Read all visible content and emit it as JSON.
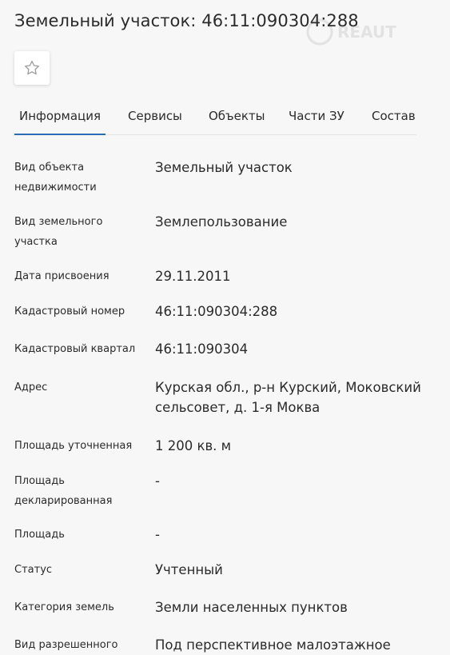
{
  "header": {
    "title": "Земельный участок: 46:11:090304:288",
    "watermark_text": "REAUT"
  },
  "favorite": {
    "icon": "star-outline-icon"
  },
  "tabs": [
    {
      "label": "Информация",
      "active": true
    },
    {
      "label": "Сервисы",
      "active": false
    },
    {
      "label": "Объекты",
      "active": false
    },
    {
      "label": "Части ЗУ",
      "active": false
    },
    {
      "label": "Состав",
      "active": false
    }
  ],
  "details": [
    {
      "label": "Вид объекта недвижимости",
      "value": "Земельный участок"
    },
    {
      "label": "Вид земельного участка",
      "value": "Землепользование"
    },
    {
      "label": "Дата присвоения",
      "value": "29.11.2011"
    },
    {
      "label": "Кадастровый номер",
      "value": "46:11:090304:288"
    },
    {
      "label": "Кадастровый квартал",
      "value": "46:11:090304"
    },
    {
      "label": "Адрес",
      "value": "Курская обл., р-н Курский, Моковский сельсовет, д. 1-я Моква"
    },
    {
      "label": "Площадь уточненная",
      "value": "1 200 кв. м"
    },
    {
      "label": "Площадь декларированная",
      "value": "-"
    },
    {
      "label": "Площадь",
      "value": "-"
    },
    {
      "label": "Статус",
      "value": "Учтенный"
    },
    {
      "label": "Категория земель",
      "value": "Земли населенных пунктов"
    },
    {
      "label": "Вид разрешенного",
      "value": "Под перспективное малоэтажное"
    }
  ],
  "colors": {
    "accent": "#2a6ab6",
    "background": "#f7f7f7"
  }
}
